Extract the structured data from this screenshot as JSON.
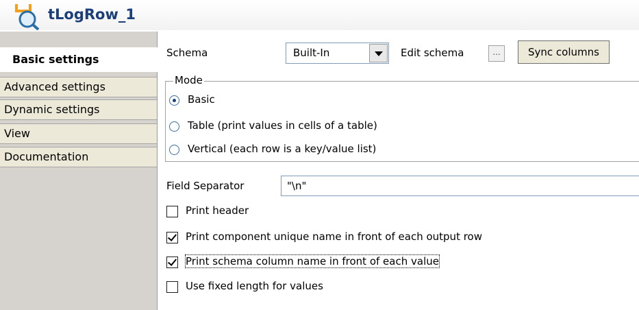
{
  "window": {
    "title": "tLogRow_1",
    "icon": "log-row-magnifier-icon"
  },
  "sidebar": {
    "items": [
      {
        "label": "Basic settings",
        "active": true
      },
      {
        "label": "Advanced settings",
        "active": false
      },
      {
        "label": "Dynamic settings",
        "active": false
      },
      {
        "label": "View",
        "active": false
      },
      {
        "label": "Documentation",
        "active": false
      }
    ]
  },
  "schema": {
    "label": "Schema",
    "selected": "Built-In",
    "edit_label": "Edit schema",
    "edit_button": "...",
    "sync_button": "Sync columns"
  },
  "mode": {
    "legend": "Mode",
    "options": [
      {
        "label": "Basic",
        "checked": true
      },
      {
        "label": "Table (print values in cells of a table)",
        "checked": false
      },
      {
        "label": "Vertical (each row is a key/value list)",
        "checked": false
      }
    ]
  },
  "field_separator": {
    "label": "Field Separator",
    "value": "\"\\n\""
  },
  "options": [
    {
      "label": "Print header",
      "checked": false
    },
    {
      "label": "Print component unique name in front of each output row",
      "checked": true
    },
    {
      "label": "Print schema column name in front of each value",
      "checked": true
    },
    {
      "label": "Use fixed length for values",
      "checked": false
    }
  ],
  "colors": {
    "title": "#1a3f7a",
    "sidebar": "#d6d3ce",
    "tab": "#ece9d8",
    "icon_orange": "#f0a020"
  }
}
